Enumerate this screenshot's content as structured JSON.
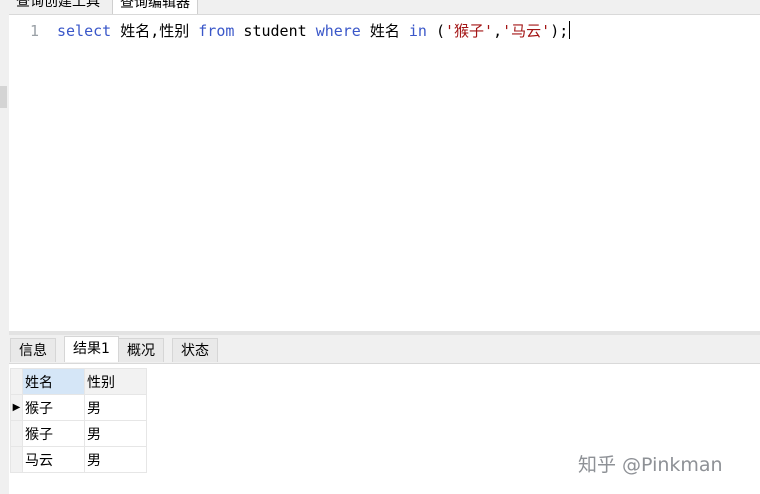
{
  "top_tabs": [
    "查询创建工具",
    "查询编辑器"
  ],
  "editor": {
    "line_number": "1",
    "tokens": {
      "select": "select",
      "columns": " 姓名,性别 ",
      "from": "from",
      "table": " student ",
      "where": "where",
      "field": " 姓名 ",
      "in": "in",
      "open": " (",
      "str1": "'猴子'",
      "comma": ",",
      "str2": "'马云'",
      "close": ");"
    }
  },
  "result_tabs": [
    "信息",
    "结果1",
    "概况",
    "状态"
  ],
  "active_result_tab": "结果1",
  "table": {
    "headers": [
      "姓名",
      "性别"
    ],
    "rows": [
      [
        "猴子",
        "男"
      ],
      [
        "猴子",
        "男"
      ],
      [
        "马云",
        "男"
      ]
    ],
    "current_row_marker": "▶"
  },
  "watermark": "知乎 @Pinkman",
  "colors": {
    "keyword": "#3a57c9",
    "string": "#a31515",
    "selected_header": "#d5e6f7"
  }
}
